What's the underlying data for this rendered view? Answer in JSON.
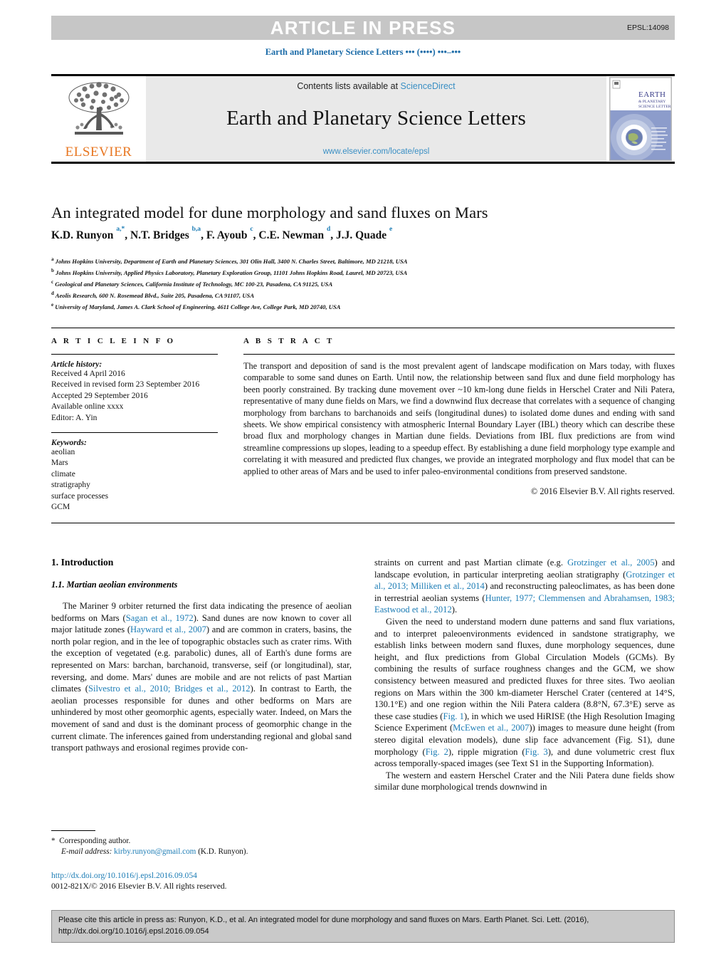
{
  "banner": {
    "label": "ARTICLE IN PRESS",
    "code": "EPSL:14098"
  },
  "running_line": "Earth and Planetary Science Letters ••• (••••) •••–•••",
  "masthead": {
    "publisher": "ELSEVIER",
    "contents_prefix": "Contents lists available at ",
    "contents_link": "ScienceDirect",
    "journal_title": "Earth and Planetary Science Letters",
    "journal_url": "www.elsevier.com/locate/epsl",
    "cover_title_line1": "EARTH",
    "cover_title_line2": "& PLANETARY",
    "cover_title_line3": "SCIENCE LETTERS"
  },
  "article": {
    "title": "An integrated model for dune morphology and sand fluxes on Mars",
    "authors_html": "K.D. Runyon <sup>a,*</sup>, N.T. Bridges <sup>b,a</sup>, F. Ayoub <sup>c</sup>, C.E. Newman <sup>d</sup>, J.J. Quade <sup>e</sup>",
    "affiliations": [
      {
        "marker": "a",
        "text": "Johns Hopkins University, Department of Earth and Planetary Sciences, 301 Olin Hall, 3400 N. Charles Street, Baltimore, MD 21218, USA"
      },
      {
        "marker": "b",
        "text": "Johns Hopkins University, Applied Physics Laboratory, Planetary Exploration Group, 11101 Johns Hopkins Road, Laurel, MD 20723, USA"
      },
      {
        "marker": "c",
        "text": "Geological and Planetary Sciences, California Institute of Technology, MC 100-23, Pasadena, CA 91125, USA"
      },
      {
        "marker": "d",
        "text": "Aeolis Research, 600 N. Rosemead Blvd., Suite 205, Pasadena, CA 91107, USA"
      },
      {
        "marker": "e",
        "text": "University of Maryland, James A. Clark School of Engineering, 4611 College Ave, College Park, MD 20740, USA"
      }
    ]
  },
  "article_info": {
    "heading": "A R T I C L E    I N F O",
    "history_label": "Article history:",
    "history_lines": [
      "Received 4 April 2016",
      "Received in revised form 23 September 2016",
      "Accepted 29 September 2016",
      "Available online xxxx",
      "Editor: A. Yin"
    ],
    "keywords_label": "Keywords:",
    "keywords": [
      "aeolian",
      "Mars",
      "climate",
      "stratigraphy",
      "surface processes",
      "GCM"
    ]
  },
  "abstract": {
    "heading": "A B S T R A C T",
    "text": "The transport and deposition of sand is the most prevalent agent of landscape modification on Mars today, with fluxes comparable to some sand dunes on Earth. Until now, the relationship between sand flux and dune field morphology has been poorly constrained. By tracking dune movement over ~10 km-long dune fields in Herschel Crater and Nili Patera, representative of many dune fields on Mars, we find a downwind flux decrease that correlates with a sequence of changing morphology from barchans to barchanoids and seifs (longitudinal dunes) to isolated dome dunes and ending with sand sheets. We show empirical consistency with atmospheric Internal Boundary Layer (IBL) theory which can describe these broad flux and morphology changes in Martian dune fields. Deviations from IBL flux predictions are from wind streamline compressions up slopes, leading to a speedup effect. By establishing a dune field morphology type example and correlating it with measured and predicted flux changes, we provide an integrated morphology and flux model that can be applied to other areas of Mars and be used to infer paleo-environmental conditions from preserved sandstone.",
    "copyright": "© 2016 Elsevier B.V. All rights reserved."
  },
  "body": {
    "section_heading": "1. Introduction",
    "subsection_heading": "1.1. Martian aeolian environments",
    "left_para_1_html": "The Mariner 9 orbiter returned the first data indicating the presence of aeolian bedforms on Mars (<span class=\"lnk\">Sagan et al., 1972</span>). Sand dunes are now known to cover all major latitude zones (<span class=\"lnk\">Hayward et al., 2007</span>) and are common in craters, basins, the north polar region, and in the lee of topographic obstacles such as crater rims. With the exception of vegetated (e.g. parabolic) dunes, all of Earth's dune forms are represented on Mars: barchan, barchanoid, transverse, seif (or longitudinal), star, reversing, and dome. Mars' dunes are mobile and are not relicts of past Martian climates (<span class=\"lnk\">Silvestro et al., 2010; Bridges et al., 2012</span>). In contrast to Earth, the aeolian processes responsible for dunes and other bedforms on Mars are unhindered by most other geomorphic agents, especially water. Indeed, on Mars the movement of sand and dust is the dominant process of geomorphic change in the current climate. The inferences gained from understanding regional and global sand transport pathways and erosional regimes provide con-",
    "right_para_1_html": "straints on current and past Martian climate (e.g. <span class=\"lnk\">Grotzinger et al., 2005</span>) and landscape evolution, in particular interpreting aeolian stratigraphy (<span class=\"lnk\">Grotzinger et al., 2013; Milliken et al., 2014</span>) and reconstructing paleoclimates, as has been done in terrestrial aeolian systems (<span class=\"lnk\">Hunter, 1977; Clemmensen and Abrahamsen, 1983; Eastwood et al., 2012</span>).",
    "right_para_2_html": "Given the need to understand modern dune patterns and sand flux variations, and to interpret paleoenvironments evidenced in sandstone stratigraphy, we establish links between modern sand fluxes, dune morphology sequences, dune height, and flux predictions from Global Circulation Models (GCMs). By combining the results of surface roughness changes and the GCM, we show consistency between measured and predicted fluxes for three sites. Two aeolian regions on Mars within the 300 km-diameter Herschel Crater (centered at 14°S, 130.1°E) and one region within the Nili Patera caldera (8.8°N, 67.3°E) serve as these case studies (<span class=\"lnk\">Fig. 1</span>), in which we used HiRISE (the High Resolution Imaging Science Experiment (<span class=\"lnk\">McEwen et al., 2007</span>)) images to measure dune height (from stereo digital elevation models), dune slip face advancement (Fig. S1), dune morphology (<span class=\"lnk\">Fig. 2</span>), ripple migration (<span class=\"lnk\">Fig. 3</span>), and dune volumetric crest flux across temporally-spaced images (see Text S1 in the Supporting Information).",
    "right_para_3_html": "The western and eastern Herschel Crater and the Nili Patera dune fields show similar dune morphological trends downwind in"
  },
  "footnote": {
    "star": "*",
    "corresponding": "Corresponding author.",
    "email_label": "E-mail address:",
    "email": "kirby.runyon@gmail.com",
    "email_suffix": "(K.D. Runyon).",
    "doi_url": "http://dx.doi.org/10.1016/j.epsl.2016.09.054",
    "issn_line": "0012-821X/© 2016 Elsevier B.V. All rights reserved."
  },
  "cite_box": {
    "line1": "Please cite this article in press as: Runyon, K.D., et al. An integrated model for dune morphology and sand fluxes on Mars. Earth Planet. Sci. Lett. (2016),",
    "line2": "http://dx.doi.org/10.1016/j.epsl.2016.09.054"
  },
  "colors": {
    "link": "#1c7cb5",
    "banner_bg": "#c6c6c6",
    "masthead_bg": "#e9e9e9",
    "elsevier_orange": "#e87722",
    "cite_bg": "#c9c9c9"
  }
}
